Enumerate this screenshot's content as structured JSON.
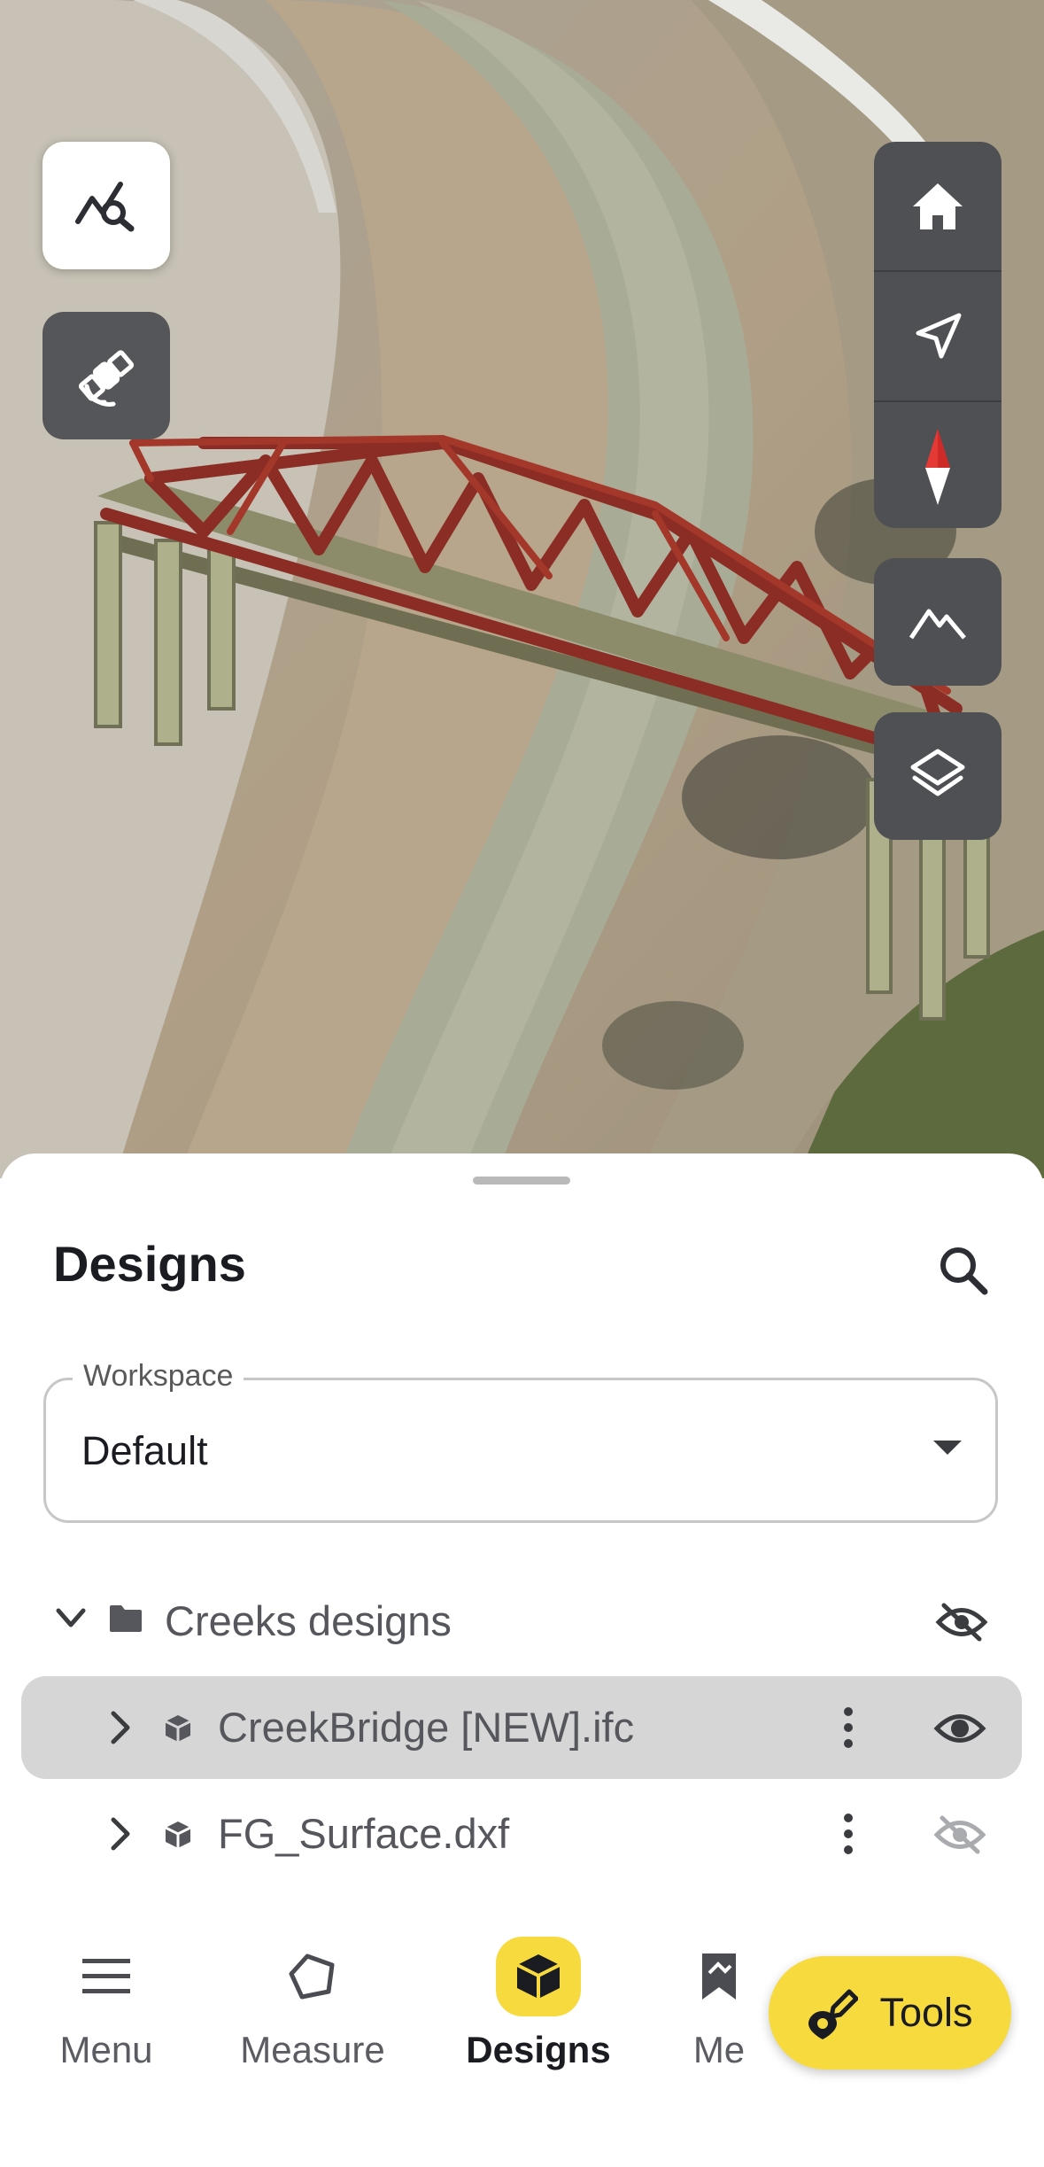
{
  "map": {
    "controls": {
      "analyze_icon": "chart-search-icon",
      "satellite_icon": "satellite-icon",
      "home_icon": "home-icon",
      "locate_icon": "navigation-arrow-icon",
      "compass_icon": "compass-icon",
      "terrain_icon": "terrain-icon",
      "layers_icon": "layers-icon"
    }
  },
  "sheet": {
    "title": "Designs",
    "workspace": {
      "label": "Workspace",
      "value": "Default"
    },
    "tree": [
      {
        "type": "folder",
        "name": "Creeks designs",
        "expanded": true,
        "visible": false
      },
      {
        "type": "file",
        "name": "CreekBridge [NEW].ifc",
        "selected": true,
        "visible": true
      },
      {
        "type": "file",
        "name": "FG_Surface.dxf",
        "selected": false,
        "visible": false
      }
    ]
  },
  "nav": {
    "items": [
      {
        "label": "Menu",
        "icon": "menu-icon"
      },
      {
        "label": "Measure",
        "icon": "polygon-icon"
      },
      {
        "label": "Designs",
        "icon": "cube-icon",
        "active": true
      },
      {
        "label": "Me",
        "icon": "bookmark-map-icon"
      }
    ],
    "tools_label": "Tools"
  },
  "colors": {
    "accent": "#f7da3e",
    "control_bg": "#4f5054",
    "compass_red": "#e53935"
  }
}
